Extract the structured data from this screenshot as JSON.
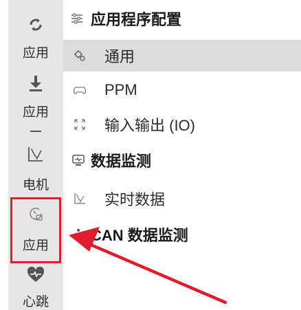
{
  "sidebar": {
    "items": [
      {
        "icon": "sync-icon",
        "label": "应用"
      },
      {
        "icon": "download-icon",
        "label": "应用"
      },
      {
        "icon": "dash-icon",
        "label": ""
      },
      {
        "icon": "motor-curve-icon",
        "label": "电机"
      },
      {
        "icon": "gauge-icon",
        "label": "应用"
      },
      {
        "icon": "heart-icon",
        "label": "心跳"
      }
    ]
  },
  "panel": {
    "app_config_header": "应用程序配置",
    "general": "通用",
    "ppm": "PPM",
    "io": "输入输出 (IO)",
    "data_monitor_header": "数据监测",
    "realtime": "实时数据",
    "can_monitor_header": "CAN 数据监测"
  },
  "colors": {
    "sidebar_bg": "#e6e6e6",
    "selected_bg": "#dcdcdc",
    "annotation_red": "#e01d2a"
  }
}
